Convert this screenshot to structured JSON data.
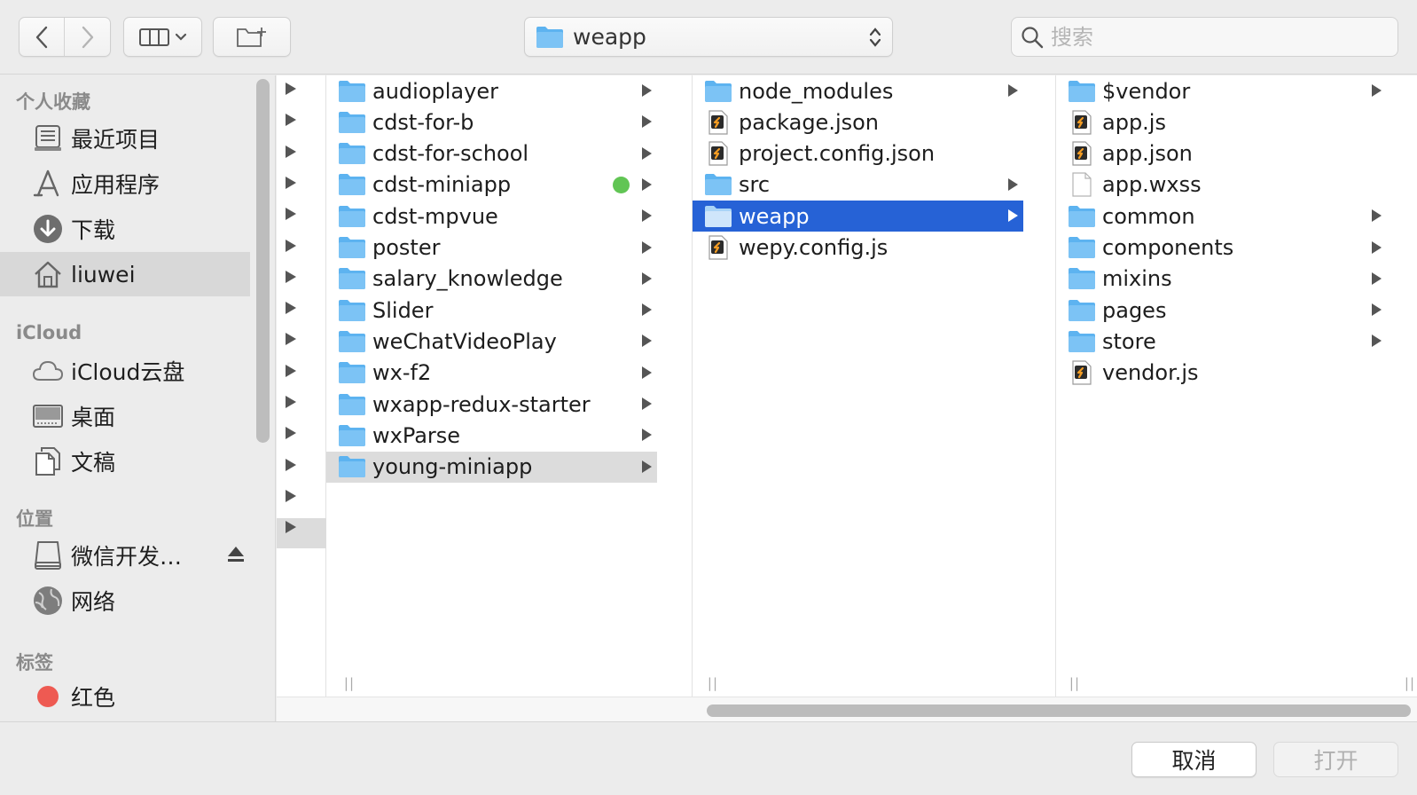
{
  "toolbar": {
    "path_label": "weapp",
    "search_placeholder": "搜索"
  },
  "sidebar": {
    "sections": [
      {
        "title": "个人收藏"
      },
      {
        "title": "iCloud"
      },
      {
        "title": "位置"
      },
      {
        "title": "标签"
      }
    ],
    "favorites": [
      {
        "label": "最近项目",
        "icon": "recents-icon"
      },
      {
        "label": "应用程序",
        "icon": "applications-icon"
      },
      {
        "label": "下载",
        "icon": "downloads-icon"
      },
      {
        "label": "liuwei",
        "icon": "home-icon",
        "selected": true
      }
    ],
    "icloud": [
      {
        "label": "iCloud云盘",
        "icon": "cloud-icon"
      },
      {
        "label": "桌面",
        "icon": "desktop-icon"
      },
      {
        "label": "文稿",
        "icon": "documents-icon"
      }
    ],
    "locations": [
      {
        "label": "微信开发…",
        "icon": "disk-icon"
      },
      {
        "label": "网络",
        "icon": "network-icon"
      }
    ],
    "tags": [
      {
        "label": "红色",
        "color": "#ee5a52"
      }
    ]
  },
  "columns": [
    {
      "items": [
        {
          "name": "audioplayer",
          "type": "folder"
        },
        {
          "name": "cdst-for-b",
          "type": "folder"
        },
        {
          "name": "cdst-for-school",
          "type": "folder"
        },
        {
          "name": "cdst-miniapp",
          "type": "folder",
          "tag": "#61c554"
        },
        {
          "name": "cdst-mpvue",
          "type": "folder"
        },
        {
          "name": "poster",
          "type": "folder"
        },
        {
          "name": "salary_knowledge",
          "type": "folder"
        },
        {
          "name": "Slider",
          "type": "folder"
        },
        {
          "name": "weChatVideoPlay",
          "type": "folder"
        },
        {
          "name": "wx-f2",
          "type": "folder"
        },
        {
          "name": "wxapp-redux-starter",
          "type": "folder"
        },
        {
          "name": "wxParse",
          "type": "folder"
        },
        {
          "name": "young-miniapp",
          "type": "folder",
          "state": "path"
        }
      ]
    },
    {
      "items": [
        {
          "name": "node_modules",
          "type": "folder"
        },
        {
          "name": "package.json",
          "type": "file-s"
        },
        {
          "name": "project.config.json",
          "type": "file-s"
        },
        {
          "name": "src",
          "type": "folder"
        },
        {
          "name": "weapp",
          "type": "folder",
          "state": "selected"
        },
        {
          "name": "wepy.config.js",
          "type": "file-s"
        }
      ]
    },
    {
      "items": [
        {
          "name": "$vendor",
          "type": "folder"
        },
        {
          "name": "app.js",
          "type": "file-s"
        },
        {
          "name": "app.json",
          "type": "file-s"
        },
        {
          "name": "app.wxss",
          "type": "file-blank"
        },
        {
          "name": "common",
          "type": "folder"
        },
        {
          "name": "components",
          "type": "folder"
        },
        {
          "name": "mixins",
          "type": "folder"
        },
        {
          "name": "pages",
          "type": "folder"
        },
        {
          "name": "store",
          "type": "folder"
        },
        {
          "name": "vendor.js",
          "type": "file-s"
        }
      ]
    }
  ],
  "footer": {
    "cancel_label": "取消",
    "open_label": "打开"
  }
}
